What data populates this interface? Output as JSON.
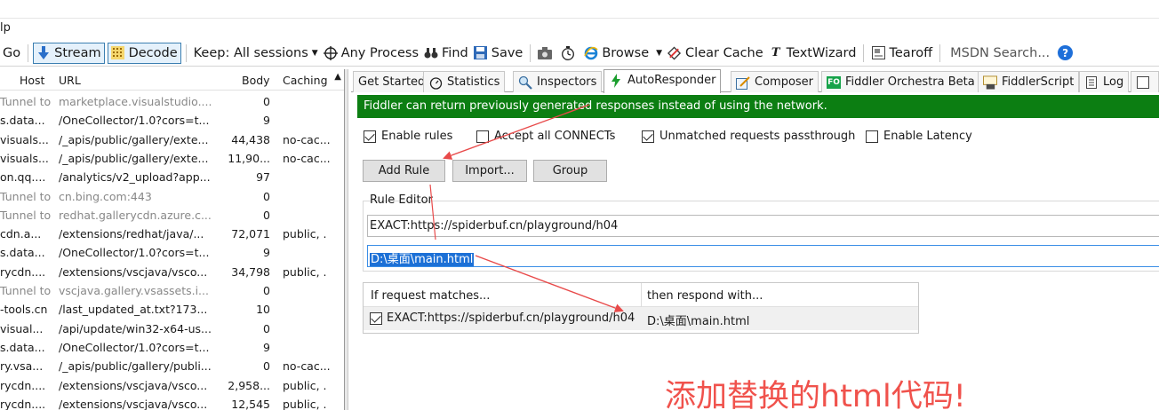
{
  "menu": {
    "partial_label": "lp"
  },
  "toolbar": {
    "go": "Go",
    "stream": "Stream",
    "decode": "Decode",
    "keep": "Keep: All sessions",
    "any_process": "Any Process",
    "find": "Find",
    "save": "Save",
    "browse": "Browse",
    "clear_cache": "Clear Cache",
    "text_wizard": "TextWizard",
    "tearoff": "Tearoff",
    "msdn_search": "MSDN Search...",
    "help": "?"
  },
  "sessions": {
    "headers": {
      "host": "Host",
      "url": "URL",
      "body": "Body",
      "caching": "Caching"
    },
    "rows": [
      {
        "host": "Tunnel to",
        "url": "marketplace.visualstudio....",
        "body": "0",
        "caching": "",
        "tunnel": true
      },
      {
        "host": "s.data...",
        "url": "/OneCollector/1.0?cors=t...",
        "body": "9",
        "caching": "",
        "tunnel": false
      },
      {
        "host": "visuals...",
        "url": "/_apis/public/gallery/exte...",
        "body": "44,438",
        "caching": "no-cac...",
        "tunnel": false
      },
      {
        "host": "visuals...",
        "url": "/_apis/public/gallery/exte...",
        "body": "11,90...",
        "caching": "no-cac...",
        "tunnel": false
      },
      {
        "host": "on.qq....",
        "url": "/analytics/v2_upload?app...",
        "body": "97",
        "caching": "",
        "tunnel": false
      },
      {
        "host": "Tunnel to",
        "url": "cn.bing.com:443",
        "body": "0",
        "caching": "",
        "tunnel": true
      },
      {
        "host": "Tunnel to",
        "url": "redhat.gallerycdn.azure.c...",
        "body": "0",
        "caching": "",
        "tunnel": true
      },
      {
        "host": "cdn.a...",
        "url": "/extensions/redhat/java/...",
        "body": "72,071",
        "caching": "public, .",
        "tunnel": false
      },
      {
        "host": "s.data...",
        "url": "/OneCollector/1.0?cors=t...",
        "body": "9",
        "caching": "",
        "tunnel": false
      },
      {
        "host": "rycdn....",
        "url": "/extensions/vscjava/vsco...",
        "body": "34,798",
        "caching": "public, .",
        "tunnel": false
      },
      {
        "host": "Tunnel to",
        "url": "vscjava.gallery.vsassets.i...",
        "body": "0",
        "caching": "",
        "tunnel": true
      },
      {
        "host": "-tools.cn",
        "url": "/last_updated_at.txt?173...",
        "body": "10",
        "caching": "",
        "tunnel": false
      },
      {
        "host": "visual...",
        "url": "/api/update/win32-x64-us...",
        "body": "0",
        "caching": "",
        "tunnel": false
      },
      {
        "host": "s.data...",
        "url": "/OneCollector/1.0?cors=t...",
        "body": "9",
        "caching": "",
        "tunnel": false
      },
      {
        "host": "ry.vsa...",
        "url": "/_apis/public/gallery/publi...",
        "body": "0",
        "caching": "no-cac...",
        "tunnel": false
      },
      {
        "host": "rycdn....",
        "url": "/extensions/vscjava/vsco...",
        "body": "2,958...",
        "caching": "public, .",
        "tunnel": false
      },
      {
        "host": "rycdn....",
        "url": "/extensions/vscjava/vsco...",
        "body": "12,545",
        "caching": "public, .",
        "tunnel": false
      }
    ]
  },
  "tabs": {
    "get_started": "Get Started",
    "statistics": "Statistics",
    "inspectors": "Inspectors",
    "autoresponder": "AutoResponder",
    "composer": "Composer",
    "fo_badge": "FO",
    "orchestra": "Fiddler Orchestra Beta",
    "fiddlerscript": "FiddlerScript",
    "log": "Log"
  },
  "autoresponder": {
    "banner": "Fiddler can return previously generated responses instead of using the network.",
    "options": {
      "enable_rules": "Enable rules",
      "accept_connects": "Accept all CONNECTs",
      "unmatched_passthrough": "Unmatched requests passthrough",
      "enable_latency": "Enable Latency"
    },
    "buttons": {
      "add_rule": "Add Rule",
      "import": "Import...",
      "group": "Group"
    },
    "rule_editor": {
      "label": "Rule Editor",
      "match_value": "EXACT:https://spiderbuf.cn/playground/h04",
      "action_value": "D:\\桌面\\main.html"
    },
    "rules_list": {
      "col_match": "If request matches...",
      "col_action": "then respond with...",
      "rows": [
        {
          "match": "EXACT:https://spiderbuf.cn/playground/h04",
          "action": "D:\\桌面\\main.html"
        }
      ]
    }
  },
  "annotation": {
    "text": "添加替换的html代码!",
    "color": "#f0524c"
  },
  "colors": {
    "banner": "#0c7e12",
    "selection": "#1c70d6",
    "arrow": "#e84a4a"
  }
}
